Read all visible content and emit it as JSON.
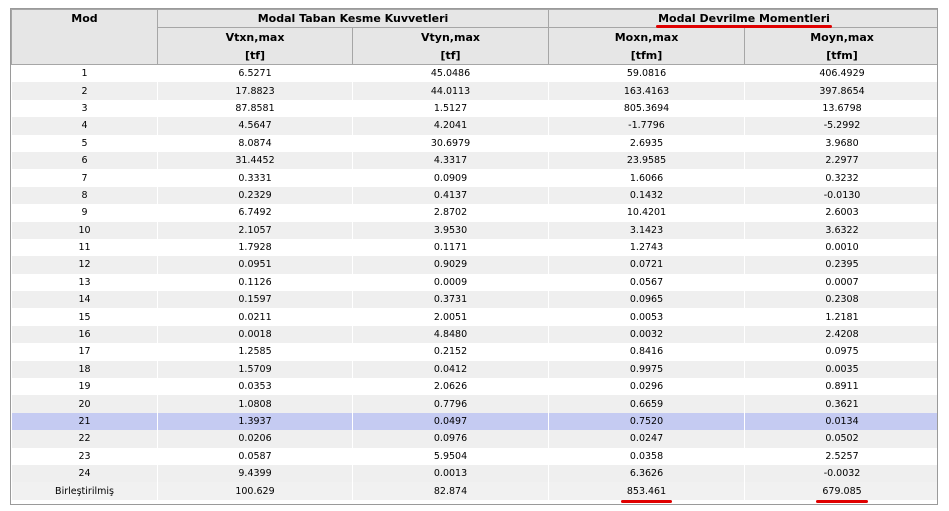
{
  "headers": {
    "mod": "Mod",
    "group_shear": "Modal Taban Kesme Kuvvetleri",
    "group_moment": "Modal Devrilme Momentleri",
    "columns": [
      {
        "name": "Vtxn,max",
        "unit": "[tf]"
      },
      {
        "name": "Vtyn,max",
        "unit": "[tf]"
      },
      {
        "name": "Moxn,max",
        "unit": "[tfm]"
      },
      {
        "name": "Moyn,max",
        "unit": "[tfm]"
      }
    ]
  },
  "rows": [
    [
      "1",
      "6.5271",
      "45.0486",
      "59.0816",
      "406.4929"
    ],
    [
      "2",
      "17.8823",
      "44.0113",
      "163.4163",
      "397.8654"
    ],
    [
      "3",
      "87.8581",
      "1.5127",
      "805.3694",
      "13.6798"
    ],
    [
      "4",
      "4.5647",
      "4.2041",
      "-1.7796",
      "-5.2992"
    ],
    [
      "5",
      "8.0874",
      "30.6979",
      "2.6935",
      "3.9680"
    ],
    [
      "6",
      "31.4452",
      "4.3317",
      "23.9585",
      "2.2977"
    ],
    [
      "7",
      "0.3331",
      "0.0909",
      "1.6066",
      "0.3232"
    ],
    [
      "8",
      "0.2329",
      "0.4137",
      "0.1432",
      "-0.0130"
    ],
    [
      "9",
      "6.7492",
      "2.8702",
      "10.4201",
      "2.6003"
    ],
    [
      "10",
      "2.1057",
      "3.9530",
      "3.1423",
      "3.6322"
    ],
    [
      "11",
      "1.7928",
      "0.1171",
      "1.2743",
      "0.0010"
    ],
    [
      "12",
      "0.0951",
      "0.9029",
      "0.0721",
      "0.2395"
    ],
    [
      "13",
      "0.1126",
      "0.0009",
      "0.0567",
      "0.0007"
    ],
    [
      "14",
      "0.1597",
      "0.3731",
      "0.0965",
      "0.2308"
    ],
    [
      "15",
      "0.0211",
      "2.0051",
      "0.0053",
      "1.2181"
    ],
    [
      "16",
      "0.0018",
      "4.8480",
      "0.0032",
      "2.4208"
    ],
    [
      "17",
      "1.2585",
      "0.2152",
      "0.8416",
      "0.0975"
    ],
    [
      "18",
      "1.5709",
      "0.0412",
      "0.9975",
      "0.0035"
    ],
    [
      "19",
      "0.0353",
      "2.0626",
      "0.0296",
      "0.8911"
    ],
    [
      "20",
      "1.0808",
      "0.7796",
      "0.6659",
      "0.3621"
    ],
    [
      "21",
      "1.3937",
      "0.0497",
      "0.7520",
      "0.0134"
    ],
    [
      "22",
      "0.0206",
      "0.0976",
      "0.0247",
      "0.0502"
    ],
    [
      "23",
      "0.0587",
      "5.9504",
      "0.0358",
      "2.5257"
    ],
    [
      "24",
      "9.4399",
      "0.0013",
      "6.3626",
      "-0.0032"
    ]
  ],
  "selected_row": "21",
  "total": {
    "label": "Birleştirilmiş",
    "values": [
      "100.629",
      "82.874",
      "853.461",
      "679.085"
    ]
  },
  "colors": {
    "header_bg": "#e6e6e6",
    "stripe_bg": "#efefef",
    "selected_bg": "#c5cbf2",
    "underline_annotation": "#e00000"
  }
}
